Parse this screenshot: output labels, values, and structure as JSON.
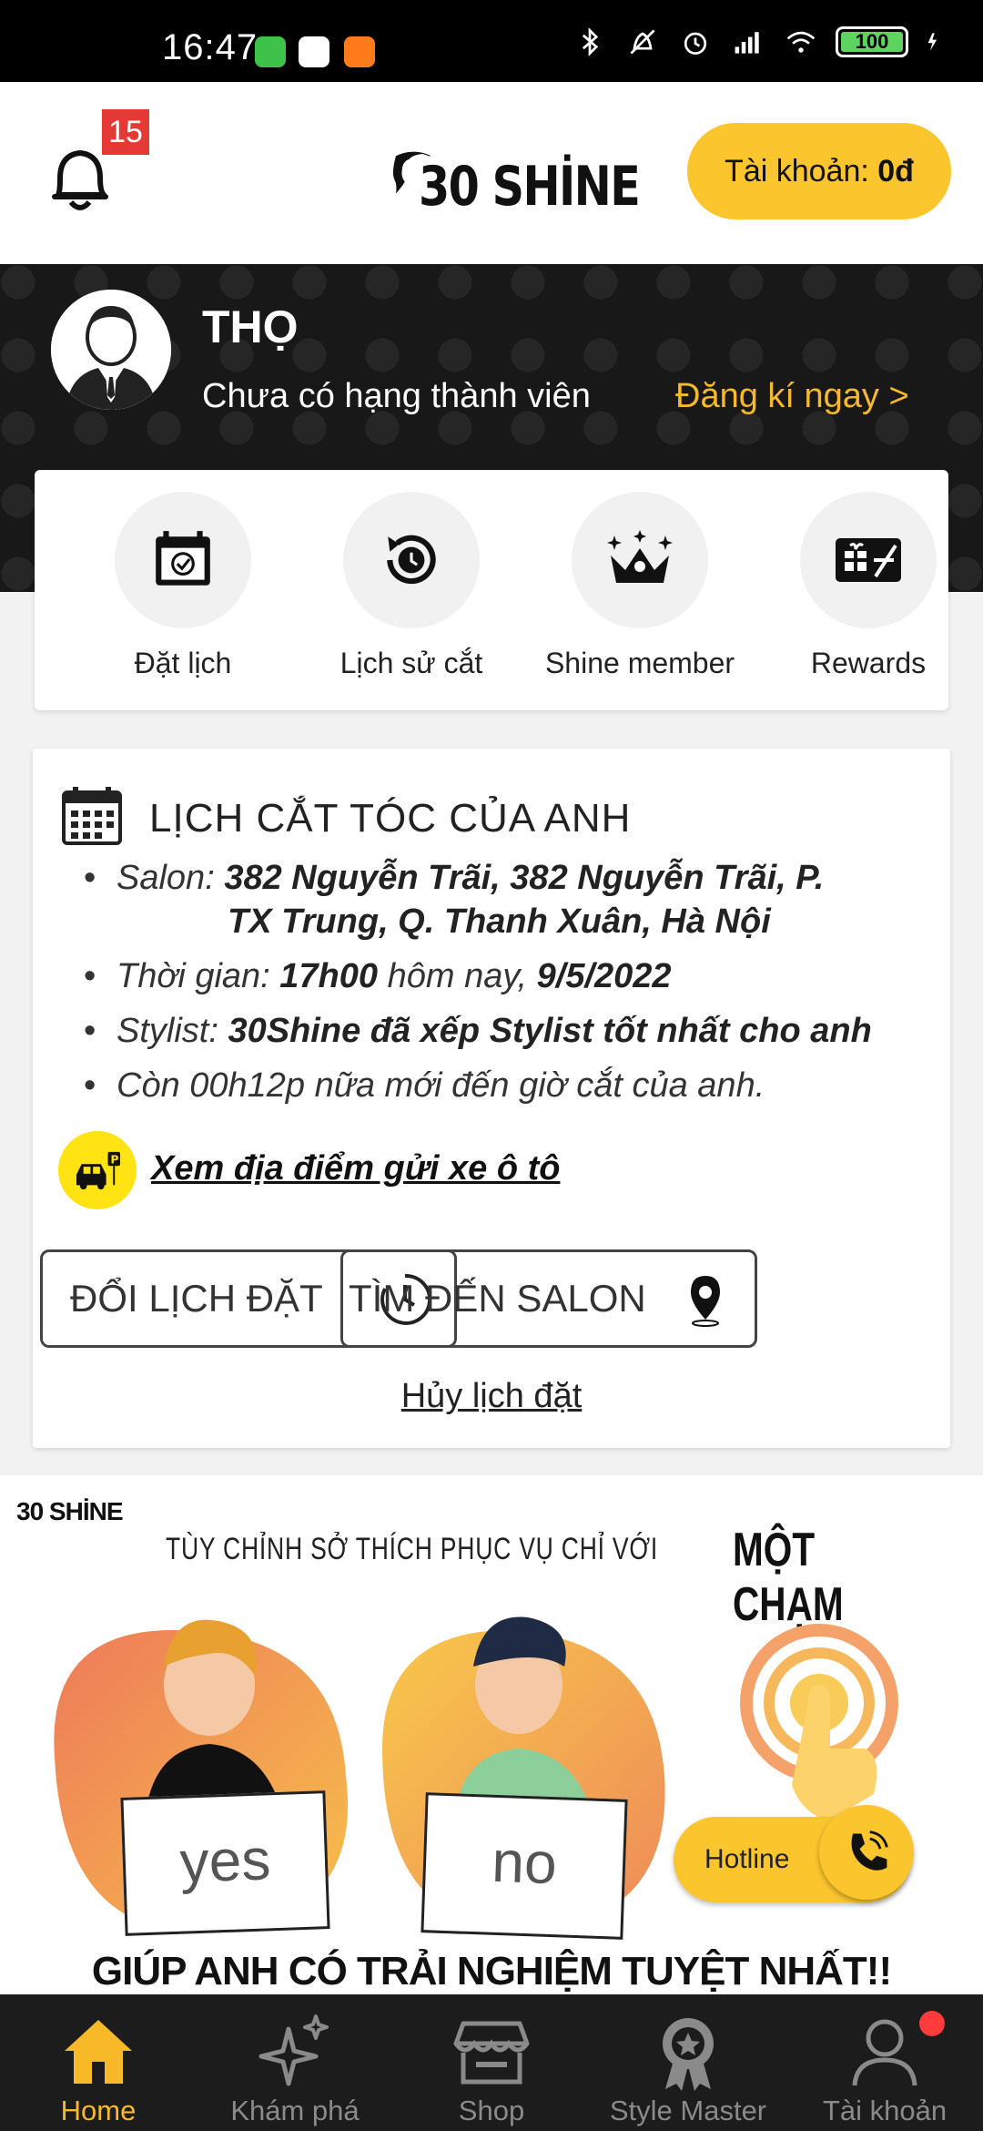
{
  "status_bar": {
    "time": "16:47",
    "battery": "100"
  },
  "header": {
    "notification_count": "15",
    "logo_text": "30 SHİNE",
    "account_label": "Tài khoản:",
    "account_balance": "0đ"
  },
  "profile": {
    "name": "THỌ",
    "rank": "Chưa có hạng thành viên",
    "register_link": "Đăng kí ngay >"
  },
  "quick_actions": [
    {
      "label": "Đặt lịch",
      "icon": "calendar-check-icon"
    },
    {
      "label": "Lịch sử cắt",
      "icon": "history-clock-icon"
    },
    {
      "label": "Shine member",
      "icon": "crown-icon"
    },
    {
      "label": "Rewards",
      "icon": "gift-card-icon"
    }
  ],
  "booking": {
    "title": "LỊCH CẮT TÓC CỦA ANH",
    "salon_label": "Salon:",
    "salon_line1": "382 Nguyễn Trãi, 382 Nguyễn Trãi, P.",
    "salon_line2": "TX Trung, Q. Thanh Xuân, Hà Nội",
    "time_label": "Thời gian:",
    "time_value": "17h00",
    "time_mid": "hôm nay,",
    "date_value": "9/5/2022",
    "stylist_label": "Stylist:",
    "stylist_value": "30Shine đã xếp Stylist tốt nhất cho anh",
    "countdown": "Còn 00h12p nữa mới đến giờ cắt của anh.",
    "parking_link": "Xem địa điểm gửi xe ô tô",
    "change_button": "ĐỔI LỊCH ĐẶT",
    "find_button": "TÌM ĐẾN SALON",
    "cancel_link": "Hủy lịch đặt"
  },
  "promo": {
    "logo": "30 SHİNE",
    "subtitle": "TÙY CHỈNH SỞ THÍCH PHỤC VỤ CHỈ VỚI",
    "one_touch": "MỘT CHẠM",
    "yes_sign": "yes",
    "no_sign": "no",
    "footer": "GIÚP ANH CÓ TRẢI NGHIỆM TUYỆT NHẤT!!",
    "hotline": "Hotline"
  },
  "bottom_nav": [
    {
      "label": "Home",
      "icon": "home-icon",
      "active": true
    },
    {
      "label": "Khám phá",
      "icon": "sparkles-icon",
      "active": false
    },
    {
      "label": "Shop",
      "icon": "store-icon",
      "active": false
    },
    {
      "label": "Style Master",
      "icon": "award-icon",
      "active": false
    },
    {
      "label": "Tài khoản",
      "icon": "user-icon",
      "active": false
    }
  ],
  "colors": {
    "accent": "#fbc52d",
    "nav_bg": "#1c1c1c",
    "badge": "#e53935"
  }
}
